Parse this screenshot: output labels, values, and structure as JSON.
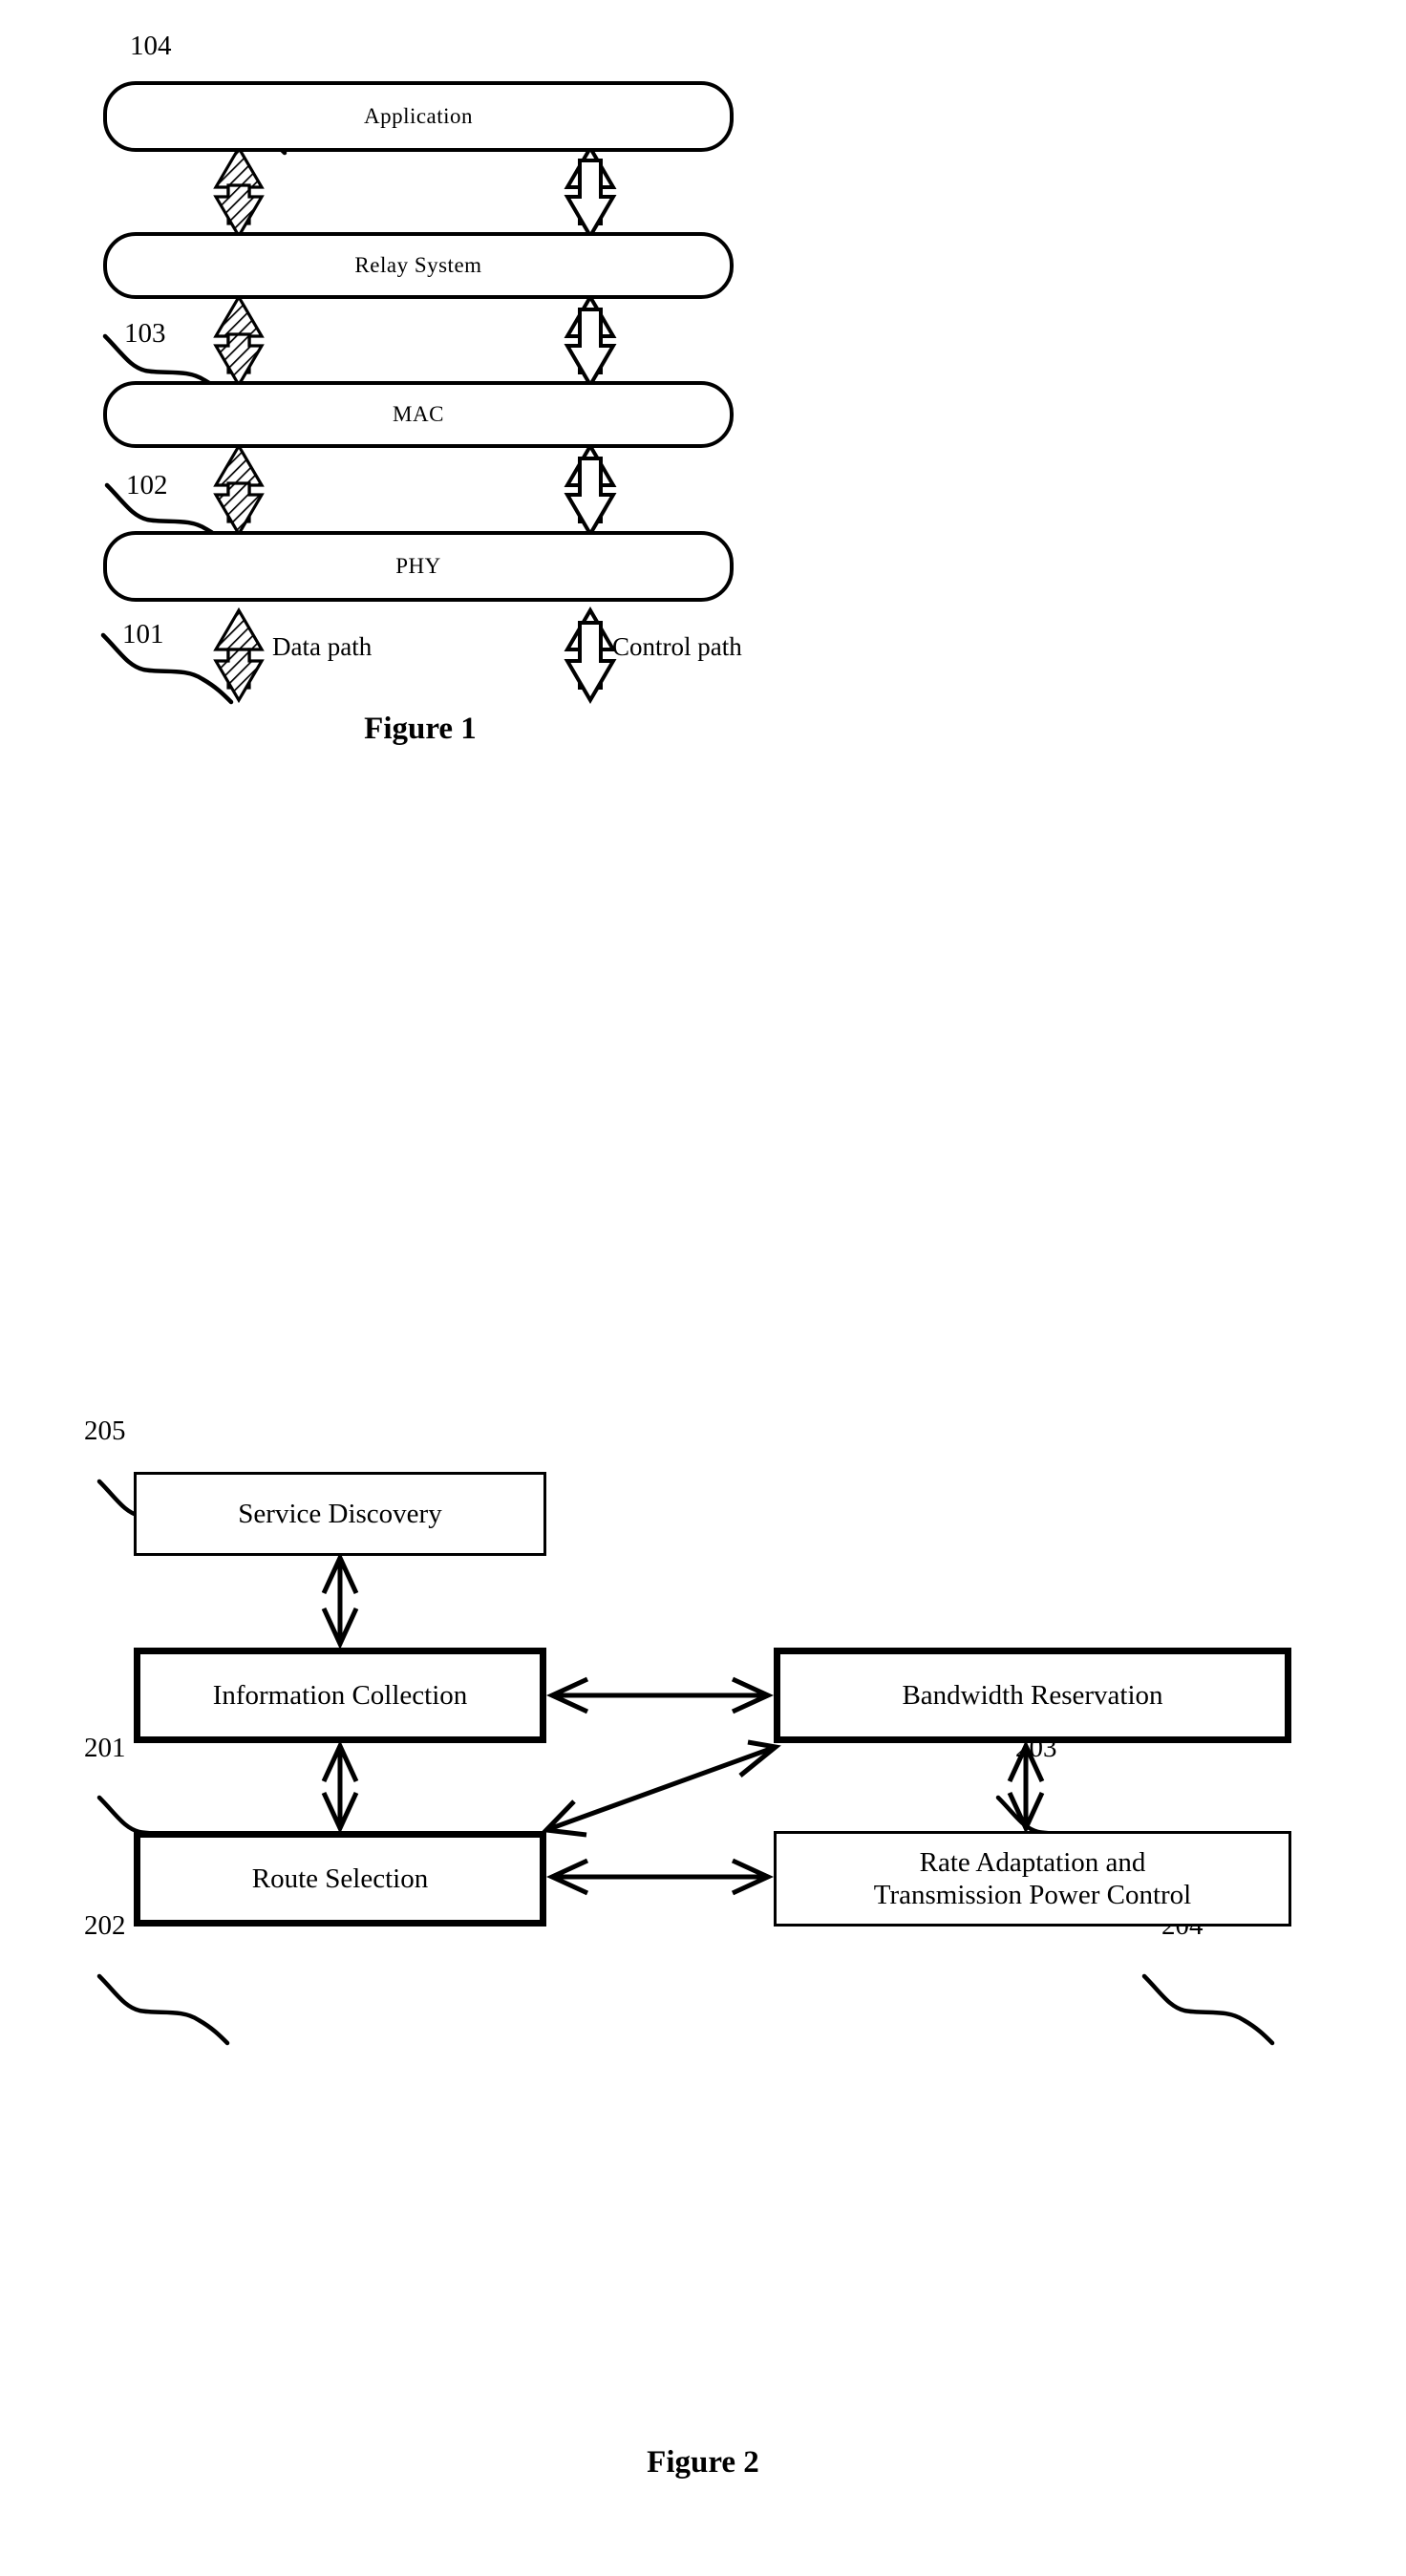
{
  "document": {
    "type": "patent-drawing-sheet",
    "background_color": "#ffffff",
    "line_color": "#000000"
  },
  "figure1": {
    "caption": "Figure 1",
    "layers": [
      {
        "ref": "104",
        "label": "Application"
      },
      {
        "ref": "103",
        "label": "Relay System"
      },
      {
        "ref": "102",
        "label": "MAC"
      },
      {
        "ref": "101",
        "label": "PHY"
      }
    ],
    "legend": [
      {
        "label": "Data path",
        "arrow_style": "hatched-double-headed"
      },
      {
        "label": "Control path",
        "arrow_style": "hollow-double-headed"
      }
    ]
  },
  "figure2": {
    "caption": "Figure 2",
    "blocks": [
      {
        "ref": "205",
        "label": "Service Discovery",
        "border": "thin"
      },
      {
        "ref": "201",
        "label": "Information Collection",
        "border": "thick"
      },
      {
        "ref": "203",
        "label": "Bandwidth Reservation",
        "border": "thick"
      },
      {
        "ref": "202",
        "label": "Route Selection",
        "border": "thick"
      },
      {
        "ref": "204",
        "label": "Rate Adaptation and\nTransmission Power Control",
        "label_line1": "Rate Adaptation and",
        "label_line2": "Transmission Power Control",
        "border": "thin"
      }
    ],
    "connections": [
      {
        "from": "205",
        "to": "201",
        "style": "double-headed-vertical"
      },
      {
        "from": "201",
        "to": "203",
        "style": "double-headed-horizontal"
      },
      {
        "from": "201",
        "to": "202",
        "style": "double-headed-vertical"
      },
      {
        "from": "203",
        "to": "204",
        "style": "double-headed-vertical"
      },
      {
        "from": "202",
        "to": "204",
        "style": "double-headed-horizontal"
      },
      {
        "from": "202",
        "to": "203",
        "style": "double-headed-diagonal"
      }
    ]
  }
}
